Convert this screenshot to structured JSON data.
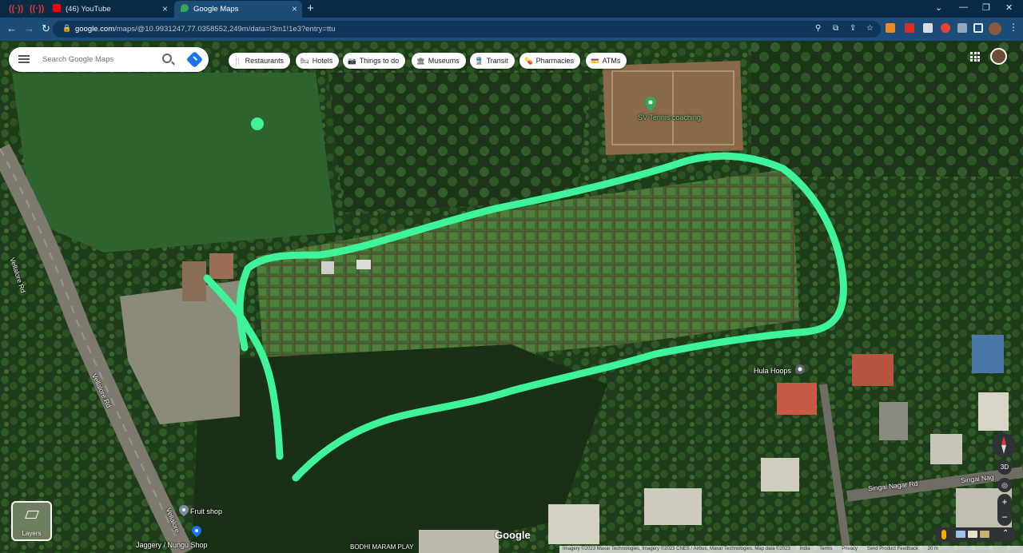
{
  "browser": {
    "tabs": [
      {
        "title": "(46) YouTube",
        "active": false
      },
      {
        "title": "Google Maps",
        "active": true
      }
    ],
    "new_tab": "+",
    "url_host": "google.com",
    "url_path": "/maps/@10.9931247,77.0358552,249m/data=!3m1!1e3?entry=ttu"
  },
  "maps": {
    "search_placeholder": "Search Google Maps",
    "categories": [
      {
        "label": "Restaurants",
        "icon": "restaurant-icon"
      },
      {
        "label": "Hotels",
        "icon": "hotel-icon"
      },
      {
        "label": "Things to do",
        "icon": "camera-icon"
      },
      {
        "label": "Museums",
        "icon": "museum-icon"
      },
      {
        "label": "Transit",
        "icon": "transit-icon"
      },
      {
        "label": "Pharmacies",
        "icon": "pharmacy-icon"
      },
      {
        "label": "ATMs",
        "icon": "atm-icon"
      }
    ],
    "places": {
      "tennis": "SV Tennis coaching",
      "hula": "Hula Hoops",
      "fruit": "Fruit shop",
      "jaggery": "Jaggery / Nungu Shop",
      "playground": "BODHI MARAM PLAY"
    },
    "roads": {
      "vellalore_1": "Vellalore Rd",
      "vellalore_2": "Vellalore Rd",
      "vellalore_3": "Vellalore",
      "singai_1": "Singai Nagar Rd",
      "singai_2": "Singai Nag"
    },
    "layers_label": "Layers",
    "view_3d": "3D",
    "zoom_in": "+",
    "zoom_out": "−",
    "google_logo": "Google",
    "attribution": "Imagery ©2023 Maxar Technologies, Imagery ©2023 CNES / Airbus, Maxar Technologies, Map data ©2023",
    "footer_links": [
      "India",
      "Terms",
      "Privacy",
      "Send Product Feedback"
    ],
    "scale": "20 m"
  },
  "colors": {
    "annotation": "#3ef39a",
    "tab_strip": "#0b2a45",
    "toolbar": "#1c4c78",
    "youtube_red": "#ff0000",
    "maps_blue": "#1a73e8"
  }
}
